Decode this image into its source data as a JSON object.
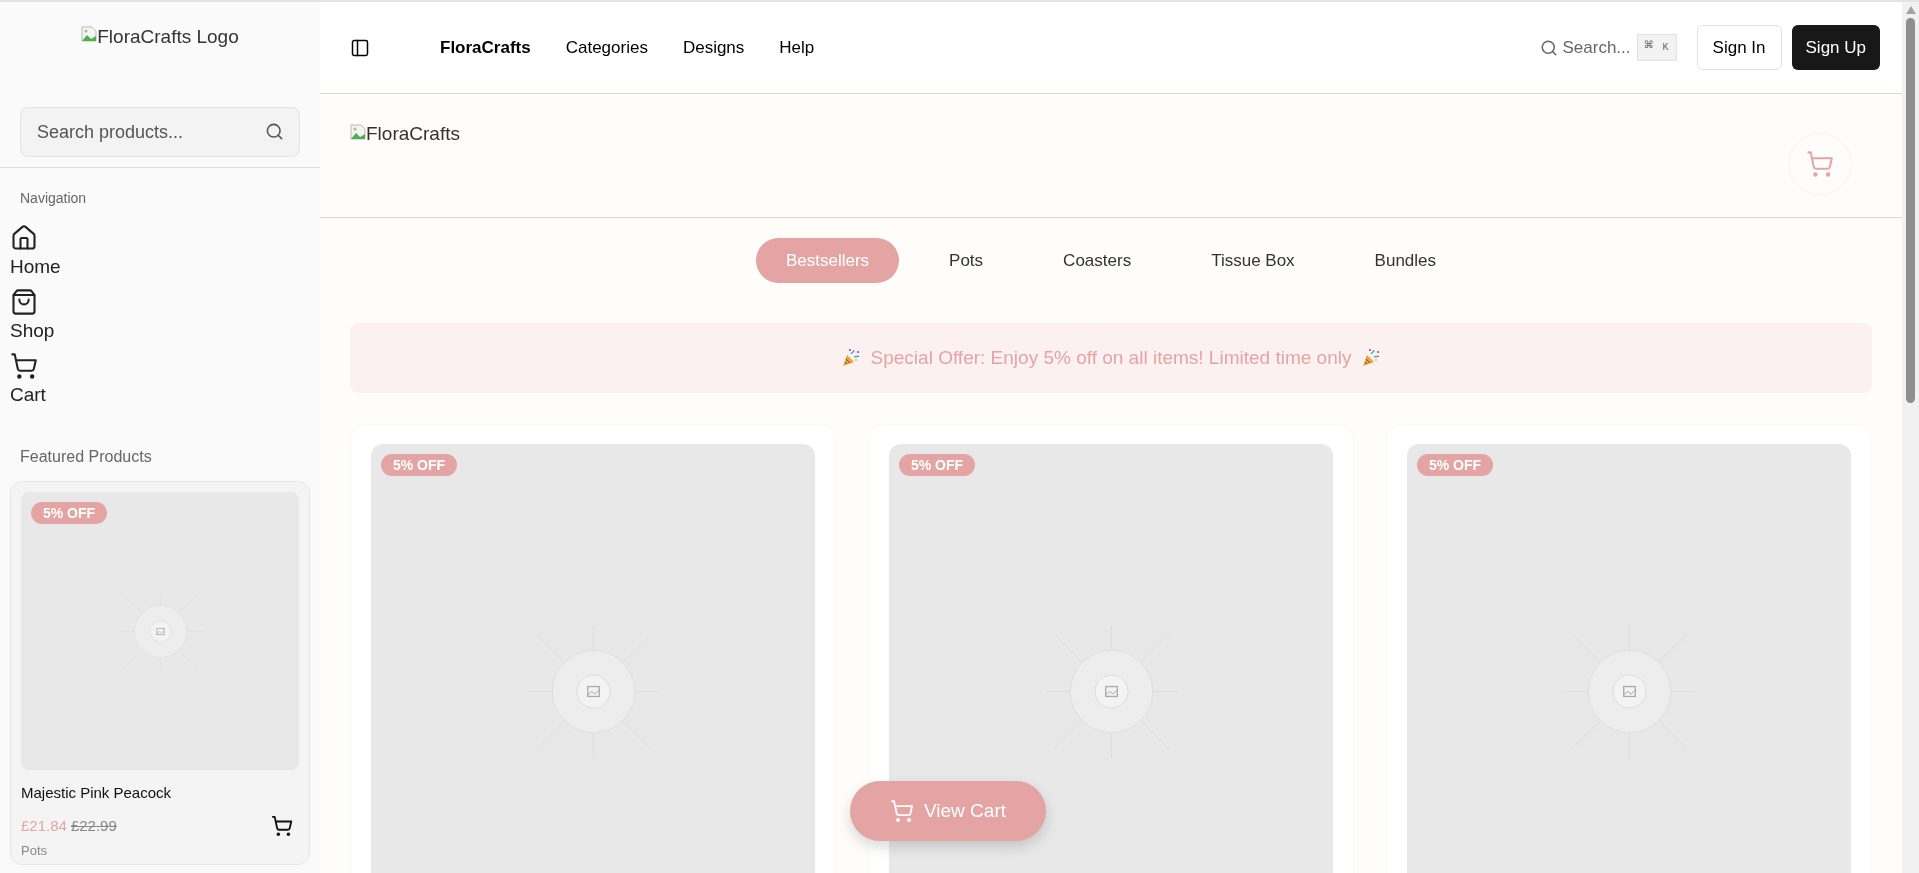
{
  "sidebar": {
    "logo_alt": "FloraCrafts Logo",
    "search": {
      "placeholder": "Search products..."
    },
    "nav_heading": "Navigation",
    "nav_items": [
      {
        "label": "Home",
        "kind": "home"
      },
      {
        "label": "Shop",
        "kind": "shop"
      },
      {
        "label": "Cart",
        "kind": "cart"
      }
    ],
    "featured_heading": "Featured Products",
    "featured_products": [
      {
        "badge": "5% OFF",
        "name": "Majestic Pink Peacock",
        "price": "£21.84",
        "old_price": "£22.99",
        "category": "Pots"
      }
    ]
  },
  "topbar": {
    "brand": "FloraCrafts",
    "links": [
      "Categories",
      "Designs",
      "Help"
    ],
    "search": {
      "label": "Search...",
      "shortcut": "⌘",
      "shortcut_key": "K"
    },
    "buttons": [
      {
        "label": "Sign In",
        "kind": "outline"
      },
      {
        "label": "Sign Up",
        "kind": "solid"
      }
    ]
  },
  "hero": {
    "logo_alt": "FloraCrafts"
  },
  "tabs": [
    {
      "label": "Bestsellers",
      "selected": true
    },
    {
      "label": "Pots",
      "selected": false
    },
    {
      "label": "Coasters",
      "selected": false
    },
    {
      "label": "Tissue Box",
      "selected": false
    },
    {
      "label": "Bundles",
      "selected": false
    }
  ],
  "banner": "Special Offer: Enjoy 5% off on all items! Limited time only",
  "products": [
    {
      "badge": "5% OFF"
    },
    {
      "badge": "5% OFF"
    },
    {
      "badge": "5% OFF"
    }
  ],
  "view_cart": "View Cart"
}
